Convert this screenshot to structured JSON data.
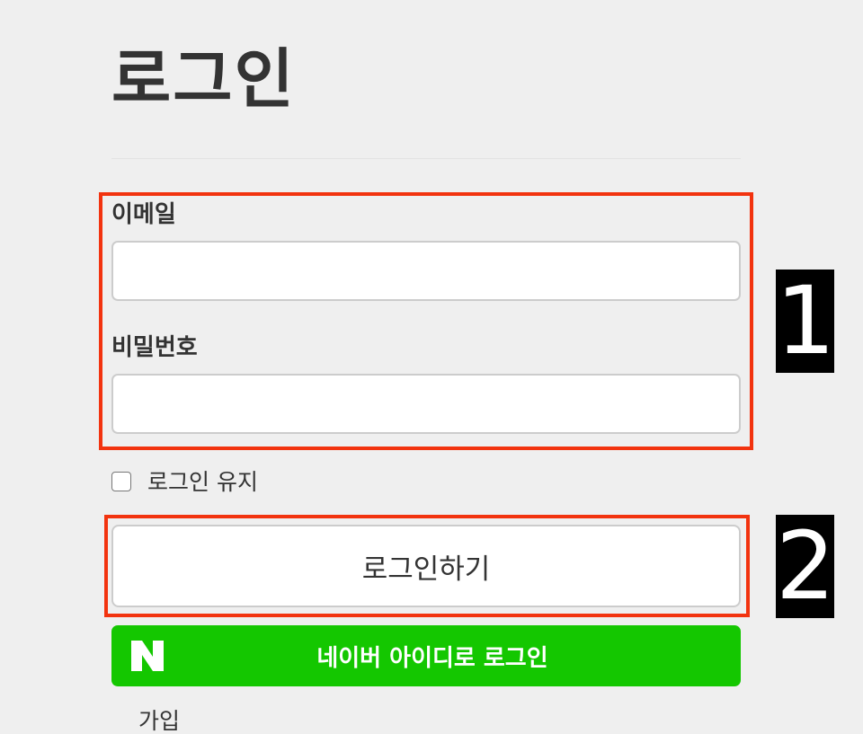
{
  "page": {
    "title": "로그인"
  },
  "form": {
    "email_label": "이메일",
    "email_value": "",
    "password_label": "비밀번호",
    "password_value": "",
    "remember_label": "로그인 유지",
    "remember_checked": false,
    "submit_label": "로그인하기"
  },
  "naver": {
    "label": "네이버 아이디로 로그인",
    "logo_icon": "naver-n-logo",
    "color": "#14c700"
  },
  "links": {
    "signup_label": "가입"
  },
  "annotations": {
    "marker_1": "1",
    "marker_2": "2",
    "highlight_color": "#f2330f"
  }
}
